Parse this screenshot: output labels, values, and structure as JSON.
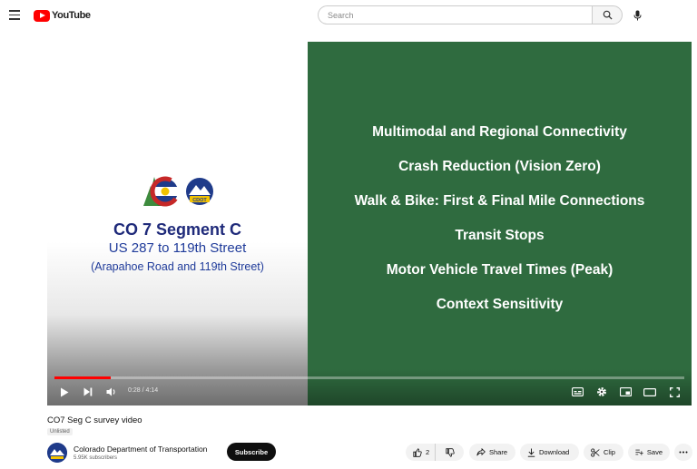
{
  "header": {
    "logo_text": "YouTube",
    "search_placeholder": "Search"
  },
  "slide": {
    "title": "CO 7 Segment C",
    "subtitle": "US 287 to 119th Street",
    "subtitle2": "(Arapahoe Road and 119th Street)",
    "logo_badge": "CDOT",
    "bullets": [
      "Multimodal and Regional Connectivity",
      "Crash Reduction (Vision Zero)",
      "Walk & Bike: First & Final Mile Connections",
      "Transit Stops",
      "Motor Vehicle Travel Times (Peak)",
      "Context Sensitivity"
    ],
    "left_bg": "#ffffff",
    "right_bg": "#2f6b3f",
    "title_color": "#1f2a7a"
  },
  "player": {
    "time": "0:28 / 4:14",
    "progress": 0.09,
    "progress_color": "#ff0000"
  },
  "video": {
    "title": "CO7 Seg C survey video",
    "visibility": "Unlisted"
  },
  "channel": {
    "name": "Colorado Department of Transportation",
    "subscribers": "5.95K subscribers",
    "subscribe_label": "Subscribe"
  },
  "actions": {
    "like_count": "2",
    "share": "Share",
    "download": "Download",
    "clip": "Clip",
    "save": "Save"
  },
  "icons": [
    "menu-icon",
    "youtube-logo-icon",
    "search-icon",
    "mic-icon",
    "play-icon",
    "next-icon",
    "volume-icon",
    "captions-icon",
    "settings-icon",
    "miniplayer-icon",
    "theater-icon",
    "fullscreen-icon",
    "like-icon",
    "dislike-icon",
    "share-icon",
    "download-icon",
    "clip-icon",
    "save-icon",
    "more-icon"
  ]
}
